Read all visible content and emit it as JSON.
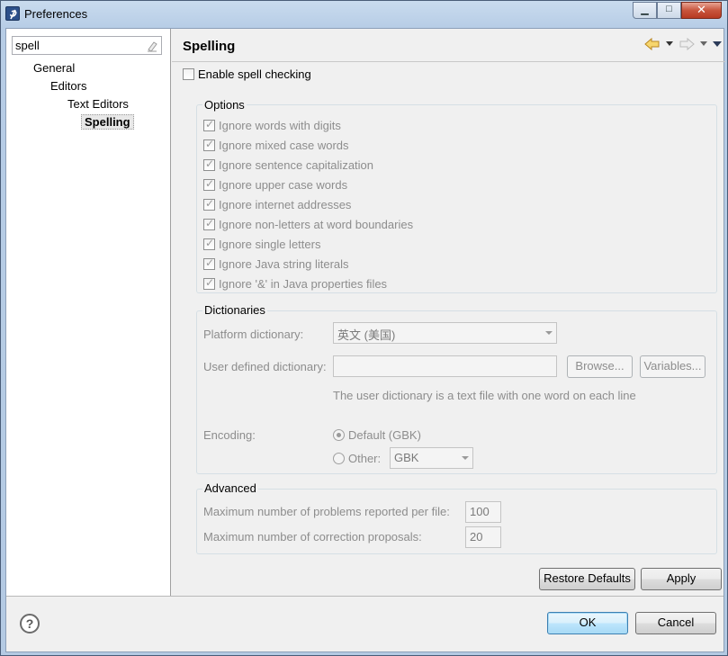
{
  "window": {
    "title": "Preferences",
    "minimize_glyph": "▁",
    "maximize_glyph": "□",
    "close_glyph": "✕"
  },
  "sidebar": {
    "filter_value": "spell",
    "items": [
      {
        "label": "General"
      },
      {
        "label": "Editors"
      },
      {
        "label": "Text Editors"
      },
      {
        "label": "Spelling"
      }
    ]
  },
  "page": {
    "title": "Spelling",
    "enable_label": "Enable spell checking",
    "enable_checked": false
  },
  "options": {
    "title": "Options",
    "items": [
      {
        "label": "Ignore words with digits",
        "checked": true
      },
      {
        "label": "Ignore mixed case words",
        "checked": true
      },
      {
        "label": "Ignore sentence capitalization",
        "checked": true
      },
      {
        "label": "Ignore upper case words",
        "checked": true
      },
      {
        "label": "Ignore internet addresses",
        "checked": true
      },
      {
        "label": "Ignore non-letters at word boundaries",
        "checked": true
      },
      {
        "label": "Ignore single letters",
        "checked": true
      },
      {
        "label": "Ignore Java string literals",
        "checked": true
      },
      {
        "label": "Ignore '&' in Java properties files",
        "checked": true
      }
    ]
  },
  "dictionaries": {
    "title": "Dictionaries",
    "platform_label": "Platform dictionary:",
    "platform_value": "英文 (美国)",
    "user_label": "User defined dictionary:",
    "user_value": "",
    "browse_label": "Browse...",
    "variables_label": "Variables...",
    "hint": "The user dictionary is a text file with one word on each line",
    "encoding_label": "Encoding:",
    "default_label": "Default (GBK)",
    "other_label": "Other:",
    "other_value": "GBK"
  },
  "advanced": {
    "title": "Advanced",
    "max_problems_label": "Maximum number of problems reported per file:",
    "max_problems_value": "100",
    "max_proposals_label": "Maximum number of correction proposals:",
    "max_proposals_value": "20"
  },
  "buttons": {
    "restore_defaults": "Restore Defaults",
    "apply": "Apply",
    "ok": "OK",
    "cancel": "Cancel",
    "help_glyph": "?"
  }
}
